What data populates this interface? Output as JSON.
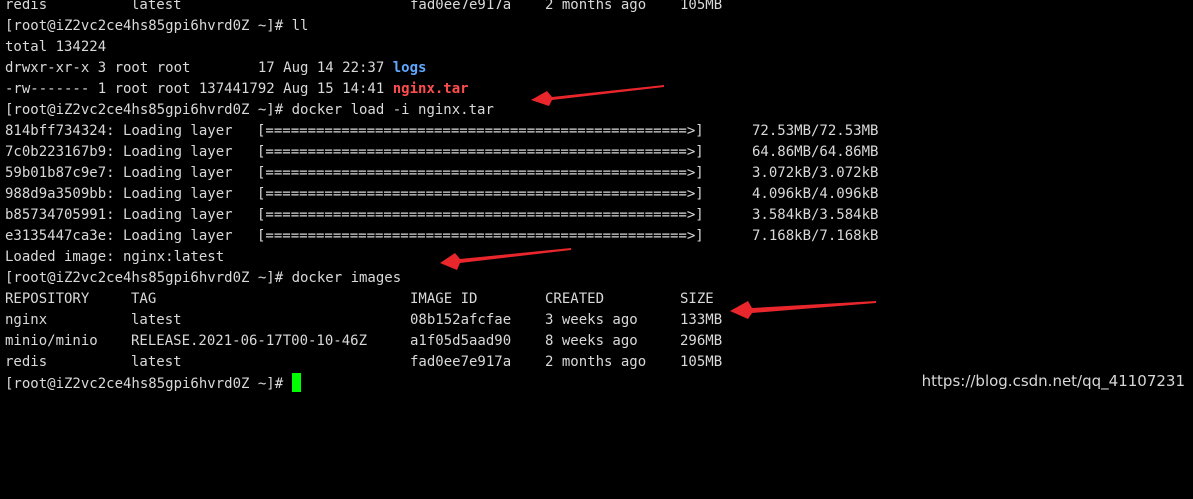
{
  "terminal": {
    "prompt": "[root@iZ2vc2ce4hs85gpi6hvrd0Z ~]# ",
    "top_partial": {
      "a": "redis",
      "b": "latest",
      "c": "fad0ee7e917a",
      "d": "2 months ago",
      "e": "105MB"
    },
    "cmd_ll": "ll",
    "total": "total 134224",
    "ls_rows": [
      {
        "prefix": "drwxr-xr-x 3 root root        17 Aug 14 22:37 ",
        "name": "logs"
      },
      {
        "prefix": "-rw------- 1 root root 137441792 Aug 15 14:41 ",
        "name": "nginx.tar"
      }
    ],
    "cmd_load": "docker load -i nginx.tar",
    "layers": [
      {
        "id": "814bff734324: Loading layer ",
        "bar": "[==================================================>]",
        "size": "72.53MB/72.53MB"
      },
      {
        "id": "7c0b223167b9: Loading layer ",
        "bar": "[==================================================>]",
        "size": "64.86MB/64.86MB"
      },
      {
        "id": "59b01b87c9e7: Loading layer ",
        "bar": "[==================================================>]",
        "size": "3.072kB/3.072kB"
      },
      {
        "id": "988d9a3509bb: Loading layer ",
        "bar": "[==================================================>]",
        "size": "4.096kB/4.096kB"
      },
      {
        "id": "b85734705991: Loading layer ",
        "bar": "[==================================================>]",
        "size": "3.584kB/3.584kB"
      },
      {
        "id": "e3135447ca3e: Loading layer ",
        "bar": "[==================================================>]",
        "size": "7.168kB/7.168kB"
      }
    ],
    "loaded": "Loaded image: nginx:latest",
    "cmd_images": "docker images",
    "images_header": {
      "repository": "REPOSITORY",
      "tag": "TAG",
      "image_id": "IMAGE ID",
      "created": "CREATED",
      "size": "SIZE"
    },
    "images": [
      {
        "repository": "nginx",
        "tag": "latest",
        "image_id": "08b152afcfae",
        "created": "3 weeks ago",
        "size": "133MB"
      },
      {
        "repository": "minio/minio",
        "tag": "RELEASE.2021-06-17T00-10-46Z",
        "image_id": "a1f05d5aad90",
        "created": "8 weeks ago",
        "size": "296MB"
      },
      {
        "repository": "redis",
        "tag": "latest",
        "image_id": "fad0ee7e917a",
        "created": "2 months ago",
        "size": "105MB"
      }
    ]
  },
  "watermark": "https://blog.csdn.net/qq_41107231",
  "colors": {
    "background": "#000000",
    "text": "#d9d9d9",
    "directory": "#5fa8ff",
    "archive": "#ff4d4d",
    "cursor": "#00ff00",
    "annotation_arrow": "#e8262b"
  }
}
